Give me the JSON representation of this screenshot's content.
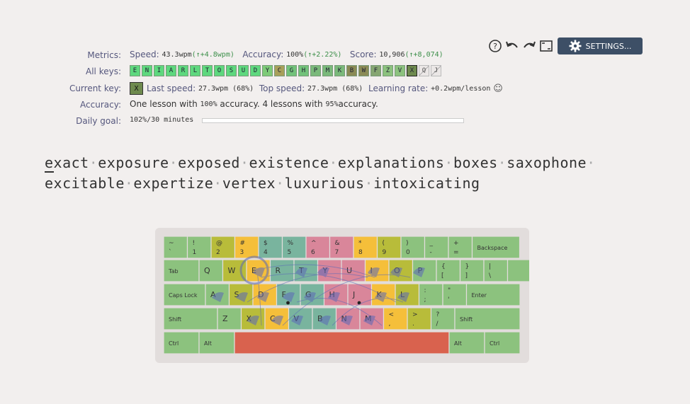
{
  "toolbar": {
    "settings_label": "SETTINGS..."
  },
  "labels": {
    "metrics": "Metrics:",
    "all_keys": "All keys:",
    "current_key": "Current key:",
    "accuracy": "Accuracy:",
    "daily_goal": "Daily goal:"
  },
  "metrics": {
    "speed_label": "Speed:",
    "speed_value": "43.3wpm",
    "speed_delta": "(↑+4.8wpm)",
    "accuracy_label": "Accuracy:",
    "accuracy_value": "100%",
    "accuracy_delta": "(↑+2.22%)",
    "score_label": "Score:",
    "score_value": "10,906",
    "score_delta": "(↑+8,074)"
  },
  "all_keys": [
    {
      "k": "E",
      "c": "#5ed87e"
    },
    {
      "k": "N",
      "c": "#5ed87e"
    },
    {
      "k": "I",
      "c": "#5ed87e"
    },
    {
      "k": "A",
      "c": "#5ed87e"
    },
    {
      "k": "R",
      "c": "#5ed87e"
    },
    {
      "k": "L",
      "c": "#5ed87e"
    },
    {
      "k": "T",
      "c": "#5ed87e"
    },
    {
      "k": "O",
      "c": "#5ed87e"
    },
    {
      "k": "S",
      "c": "#5ed87e"
    },
    {
      "k": "U",
      "c": "#5ed87e"
    },
    {
      "k": "D",
      "c": "#5ed87e"
    },
    {
      "k": "Y",
      "c": "#7ecb78"
    },
    {
      "k": "C",
      "c": "#a8a05a"
    },
    {
      "k": "G",
      "c": "#72c27a"
    },
    {
      "k": "H",
      "c": "#72c27a"
    },
    {
      "k": "P",
      "c": "#7ab97a"
    },
    {
      "k": "M",
      "c": "#7ab97a"
    },
    {
      "k": "K",
      "c": "#7ab97a"
    },
    {
      "k": "B",
      "c": "#8a8a55"
    },
    {
      "k": "W",
      "c": "#8a8a55"
    },
    {
      "k": "F",
      "c": "#86a672"
    },
    {
      "k": "Z",
      "c": "#8cc27e"
    },
    {
      "k": "V",
      "c": "#8cc27e"
    },
    {
      "k": "X",
      "c": "#6e8a4e"
    },
    {
      "k": "Q",
      "c": "#e8e4e3"
    },
    {
      "k": "J",
      "c": "#e8e4e3"
    }
  ],
  "current_key": {
    "key": "X",
    "last_speed_label": "Last speed:",
    "last_speed": "27.3wpm (68%)",
    "top_speed_label": "Top speed:",
    "top_speed": "27.3wpm (68%)",
    "learning_rate_label": "Learning rate:",
    "learning_rate": "+0.2wpm/lesson",
    "mood": "☺"
  },
  "accuracy_text": {
    "part1": "One lesson with ",
    "v1": "100%",
    "part2": " accuracy. 4 lessons with ",
    "v2": "95%",
    "part3": " accuracy."
  },
  "daily_goal": {
    "value": "102%/30 minutes",
    "progress": 1.02
  },
  "lesson": {
    "first_char": "e",
    "words_line1": [
      "xact",
      "exposure",
      "exposed",
      "existence",
      "explanations",
      "boxes",
      "saxophone"
    ],
    "words_line2": [
      "excitable",
      "expertize",
      "vertex",
      "luxurious",
      "intoxicating"
    ]
  },
  "keyboard": {
    "colors": {
      "green": "#8cc27e",
      "olive": "#b8bc3a",
      "orange": "#f5bf3a",
      "teal": "#79b49e",
      "pink": "#d9869a",
      "red": "#d9624e"
    },
    "row1": [
      [
        "~",
        "`"
      ],
      [
        "!",
        "1"
      ],
      [
        "@",
        "2"
      ],
      [
        "#",
        "3"
      ],
      [
        "$",
        "4"
      ],
      [
        "%",
        "5"
      ],
      [
        "^",
        "6"
      ],
      [
        "&",
        "7"
      ],
      [
        "*",
        "8"
      ],
      [
        "(",
        "9"
      ],
      [
        ")",
        "0"
      ],
      [
        "_",
        "-"
      ],
      [
        "+",
        "="
      ]
    ],
    "row2": [
      "Q",
      "W",
      "E",
      "R",
      "T",
      "Y",
      "U",
      "I",
      "O",
      "P"
    ],
    "row2_sym": [
      [
        "{",
        "["
      ],
      [
        "}",
        "]"
      ],
      [
        "|",
        "\\"
      ]
    ],
    "row3": [
      "A",
      "S",
      "D",
      "F",
      "G",
      "H",
      "J",
      "K",
      "L"
    ],
    "row3_sym": [
      [
        ":",
        ";"
      ],
      [
        "\"",
        "'"
      ]
    ],
    "row4": [
      "Z",
      "X",
      "C",
      "V",
      "B",
      "N",
      "M"
    ],
    "row4_sym": [
      [
        "<",
        ","
      ],
      [
        ">",
        "."
      ],
      [
        "?",
        "/"
      ]
    ],
    "mods": {
      "backspace": "Backspace",
      "tab": "Tab",
      "caps": "Caps Lock",
      "enter": "Enter",
      "shift": "Shift",
      "ctrl": "Ctrl",
      "alt": "Alt"
    }
  }
}
